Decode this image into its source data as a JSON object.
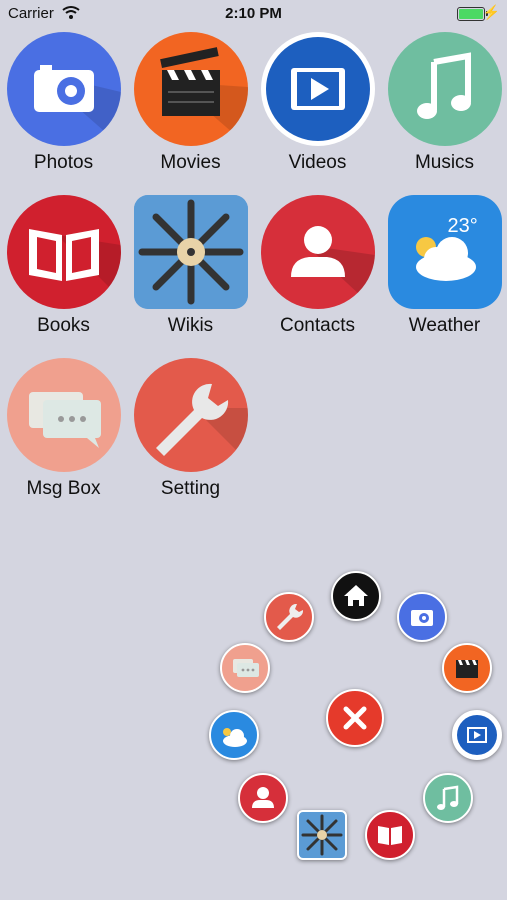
{
  "status_bar": {
    "carrier": "Carrier",
    "time": "2:10 PM"
  },
  "apps": [
    {
      "label": "Photos",
      "icon": "camera-icon",
      "color": "#4a6fe3"
    },
    {
      "label": "Movies",
      "icon": "clapperboard-icon",
      "color": "#f26522"
    },
    {
      "label": "Videos",
      "icon": "video-play-icon",
      "color": "#1d5fbf"
    },
    {
      "label": "Musics",
      "icon": "music-note-icon",
      "color": "#6fbea0"
    },
    {
      "label": "Books",
      "icon": "book-icon",
      "color": "#d0202e"
    },
    {
      "label": "Wikis",
      "icon": "pencils-icon",
      "color": "#6fa8dc"
    },
    {
      "label": "Contacts",
      "icon": "contact-icon",
      "color": "#d62f3a"
    },
    {
      "label": "Weather",
      "icon": "weather-icon",
      "color": "#2a8ae0",
      "temperature": "23°"
    },
    {
      "label": "Msg Box",
      "icon": "message-icon",
      "color": "#f0a08e"
    },
    {
      "label": "Setting",
      "icon": "wrench-icon",
      "color": "#e35a4b"
    }
  ],
  "radial_menu": {
    "center": {
      "icon": "close-icon",
      "color": "#e53a2b"
    },
    "items": [
      {
        "icon": "home-icon"
      },
      {
        "icon": "camera-icon"
      },
      {
        "icon": "clapperboard-icon"
      },
      {
        "icon": "video-play-icon"
      },
      {
        "icon": "music-note-icon"
      },
      {
        "icon": "book-icon"
      },
      {
        "icon": "pencils-icon"
      },
      {
        "icon": "contact-icon"
      },
      {
        "icon": "weather-icon"
      },
      {
        "icon": "message-icon"
      },
      {
        "icon": "wrench-icon"
      }
    ]
  }
}
